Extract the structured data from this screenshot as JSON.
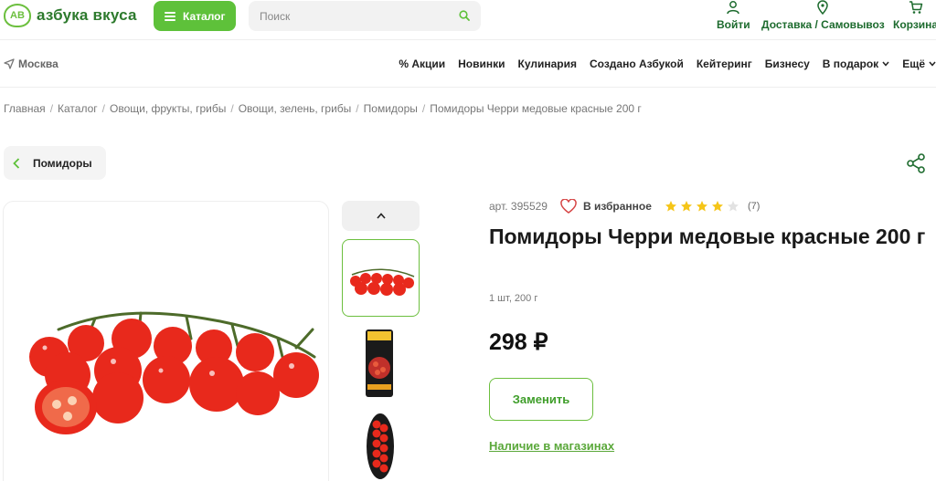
{
  "brand": {
    "name": "азбука вкуса",
    "color": "#5ec13a"
  },
  "header": {
    "catalog_label": "Каталог",
    "search_placeholder": "Поиск",
    "actions": [
      {
        "label": "Войти",
        "icon": "user-icon"
      },
      {
        "label": "Доставка / Самовывоз",
        "icon": "location-pin-icon"
      },
      {
        "label": "Корзина",
        "icon": "cart-icon"
      }
    ]
  },
  "nav": {
    "city": "Москва",
    "items": [
      "% Акции",
      "Новинки",
      "Кулинария",
      "Создано Азбукой",
      "Кейтеринг",
      "Бизнесу",
      "В подарок",
      "Ещё"
    ]
  },
  "breadcrumbs": [
    "Главная",
    "Каталог",
    "Овощи, фрукты, грибы",
    "Овощи, зелень, грибы",
    "Помидоры",
    "Помидоры Черри медовые красные 200 г"
  ],
  "back_label": "Помидоры",
  "product": {
    "article": "арт. 395529",
    "favorite_label": "В избранное",
    "rating": 4,
    "rating_max": 5,
    "rating_count": "(7)",
    "title": "Помидоры Черри медовые красные 200 г",
    "quantity": "1 шт, 200 г",
    "price": "298 ₽",
    "replace_label": "Заменить",
    "stores_link": "Наличие в магазинах"
  },
  "colors": {
    "accent": "#5ec13a",
    "star": "#f5c518",
    "heart": "#d64545"
  }
}
